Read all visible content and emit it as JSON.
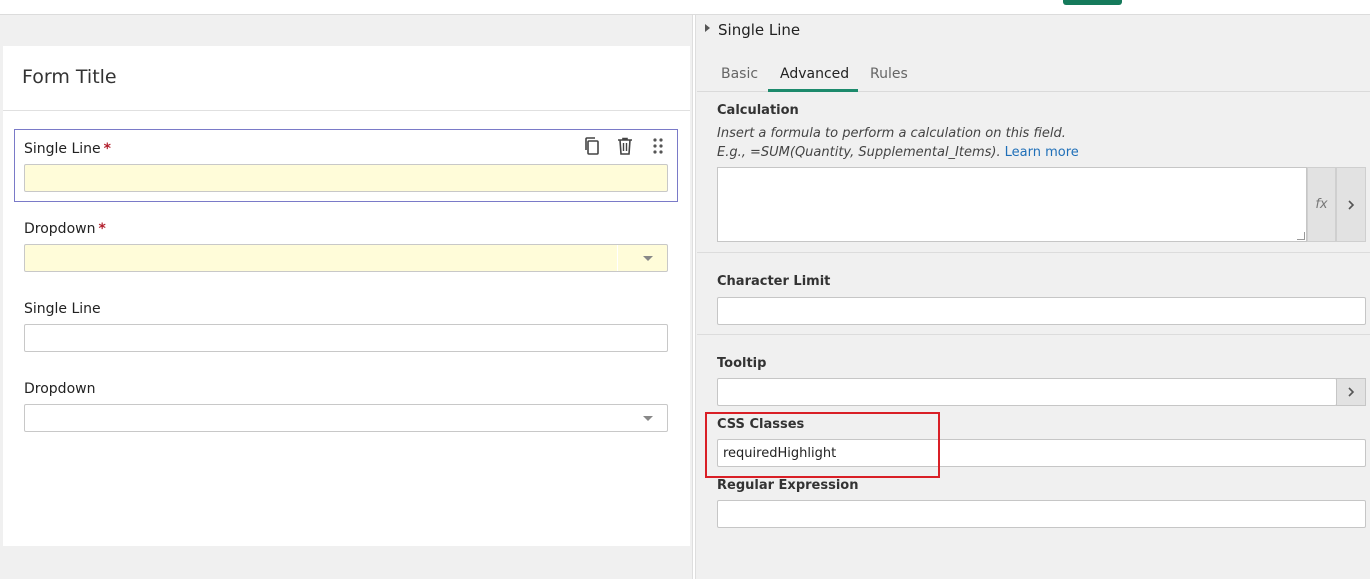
{
  "form": {
    "title": "Form Title",
    "fields": [
      {
        "label": "Single Line",
        "required": "*"
      },
      {
        "label": "Dropdown",
        "required": "*"
      },
      {
        "label": "Single Line"
      },
      {
        "label": "Dropdown"
      }
    ]
  },
  "toolbar_icons": [
    "copy-icon",
    "trash-icon",
    "drag-handle-icon"
  ],
  "panel": {
    "title": "Single Line",
    "tabs": [
      {
        "label": "Basic"
      },
      {
        "label": "Advanced",
        "active": true
      },
      {
        "label": "Rules"
      }
    ],
    "calculation": {
      "label": "Calculation",
      "hint1": "Insert a formula to perform a calculation on this field.",
      "hint2": "E.g., =SUM(Quantity, Supplemental_Items).",
      "learn_more": "Learn more",
      "fx": "fx"
    },
    "character_limit": {
      "label": "Character Limit",
      "value": ""
    },
    "tooltip": {
      "label": "Tooltip",
      "value": ""
    },
    "css_classes": {
      "label": "CSS Classes",
      "value": "requiredHighlight"
    },
    "regex": {
      "label": "Regular Expression",
      "value": ""
    }
  },
  "colors": {
    "accent": "#1c8a6c",
    "required_highlight": "#fffcd9",
    "annotation_box": "#d91f26"
  }
}
